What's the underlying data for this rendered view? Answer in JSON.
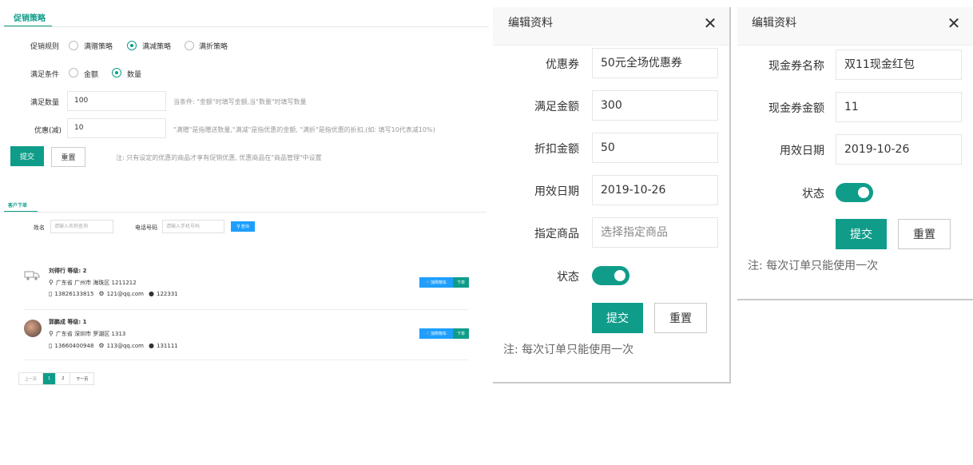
{
  "promo": {
    "tab": "促销策略",
    "rule_label": "促销规则",
    "rule_options": [
      "满赠策略",
      "满减策略",
      "满折策略"
    ],
    "cond_label": "满足条件",
    "cond_options": [
      "金额",
      "数量"
    ],
    "qty_label": "满足数量",
    "qty_value": "100",
    "qty_hint": "当条件: \"金额\"时填写金额,当\"数量\"时填写数量",
    "discount_label": "优惠(减)",
    "discount_value": "10",
    "discount_hint": "\"满赠\"是指赠送数量,\"满减\"是指优惠的金额, \"满折\"是指优惠的折扣,(如: 填写10代表减10%)",
    "submit": "提交",
    "reset": "重置",
    "note": "注: 只有设定的优惠的商品才享有促销优惠, 优惠商品在\"商品管理\"中设置"
  },
  "customer": {
    "tab": "客户下单",
    "name_label": "姓名",
    "name_placeholder": "请输入名称查询",
    "phone_label": "电话号码",
    "phone_placeholder": "请输入手机号码",
    "query": "查询",
    "rows": [
      {
        "name": "刘得行  等级: 2",
        "address": "广东省 广州市 海珠区 1211212",
        "phone": "13826133815",
        "email": "121@qq.com",
        "qq": "122331",
        "cart": "加购物车",
        "order": "下单"
      },
      {
        "name": "郭鹏成  等级: 1",
        "address": "广东省 深圳市 罗湖区 1313",
        "phone": "13660400948",
        "email": "113@qq.com",
        "qq": "131111",
        "cart": "加购物车",
        "order": "下单"
      }
    ],
    "pager": {
      "prev": "上一页",
      "p1": "1",
      "p2": "2",
      "next": "下一页"
    }
  },
  "dialog1": {
    "title": "编辑资料",
    "fields": [
      {
        "label": "优惠券",
        "value": "50元全场优惠券"
      },
      {
        "label": "满足金额",
        "value": "300"
      },
      {
        "label": "折扣金额",
        "value": "50"
      },
      {
        "label": "用效日期",
        "value": "2019-10-26"
      },
      {
        "label": "指定商品",
        "placeholder": "选择指定商品"
      }
    ],
    "status_label": "状态",
    "submit": "提交",
    "reset": "重置",
    "note": "注: 每次订单只能使用一次"
  },
  "dialog2": {
    "title": "编辑资料",
    "fields": [
      {
        "label": "现金券名称",
        "value": "双11现金红包"
      },
      {
        "label": "现金券金额",
        "value": "11"
      },
      {
        "label": "用效日期",
        "value": "2019-10-26"
      }
    ],
    "status_label": "状态",
    "submit": "提交",
    "reset": "重置",
    "note": "注: 每次订单只能使用一次"
  },
  "colors": {
    "primary": "#0f9d8a",
    "blue": "#1e9fff"
  }
}
